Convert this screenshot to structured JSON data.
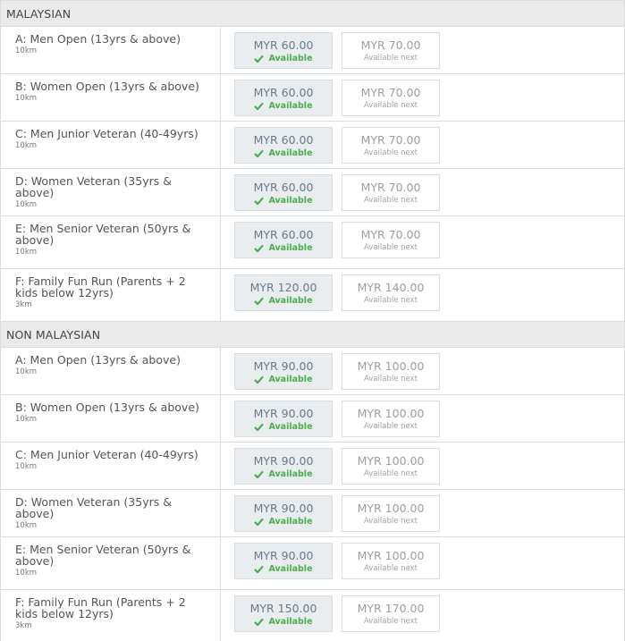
{
  "sections": [
    {
      "title": "MALAYSIAN",
      "rows": [
        {
          "name": "A: Men Open (13yrs & above)",
          "distance": "10km",
          "price": "MYR 60.00",
          "status": "Available",
          "next_price": "MYR 70.00",
          "next_status": "Available next"
        },
        {
          "name": "B: Women Open (13yrs & above)",
          "distance": "10km",
          "price": "MYR 60.00",
          "status": "Available",
          "next_price": "MYR 70.00",
          "next_status": "Available next"
        },
        {
          "name": "C: Men Junior Veteran (40-49yrs)",
          "distance": "10km",
          "price": "MYR 60.00",
          "status": "Available",
          "next_price": "MYR 70.00",
          "next_status": "Available next"
        },
        {
          "name": "D: Women Veteran (35yrs & above)",
          "distance": "10km",
          "price": "MYR 60.00",
          "status": "Available",
          "next_price": "MYR 70.00",
          "next_status": "Available next"
        },
        {
          "name": "E: Men Senior Veteran (50yrs & above)",
          "distance": "10km",
          "price": "MYR 60.00",
          "status": "Available",
          "next_price": "MYR 70.00",
          "next_status": "Available next"
        },
        {
          "name": "F: Family Fun Run (Parents + 2 kids below 12yrs)",
          "distance": "3km",
          "price": "MYR 120.00",
          "status": "Available",
          "next_price": "MYR 140.00",
          "next_status": "Available next"
        }
      ]
    },
    {
      "title": "NON MALAYSIAN",
      "rows": [
        {
          "name": "A: Men Open (13yrs & above)",
          "distance": "10km",
          "price": "MYR 90.00",
          "status": "Available",
          "next_price": "MYR 100.00",
          "next_status": "Available next"
        },
        {
          "name": "B: Women Open (13yrs & above)",
          "distance": "10km",
          "price": "MYR 90.00",
          "status": "Available",
          "next_price": "MYR 100.00",
          "next_status": "Available next"
        },
        {
          "name": "C: Men Junior Veteran (40-49yrs)",
          "distance": "10km",
          "price": "MYR 90.00",
          "status": "Available",
          "next_price": "MYR 100.00",
          "next_status": "Available next"
        },
        {
          "name": "D: Women Veteran (35yrs & above)",
          "distance": "10km",
          "price": "MYR 90.00",
          "status": "Available",
          "next_price": "MYR 100.00",
          "next_status": "Available next"
        },
        {
          "name": "E: Men Senior Veteran (50yrs & above)",
          "distance": "10km",
          "price": "MYR 90.00",
          "status": "Available",
          "next_price": "MYR 100.00",
          "next_status": "Available next"
        },
        {
          "name": "F: Family Fun Run (Parents + 2 kids below 12yrs)",
          "distance": "3km",
          "price": "MYR 150.00",
          "status": "Available",
          "next_price": "MYR 170.00",
          "next_status": "Available next"
        }
      ]
    }
  ],
  "colors": {
    "available": "#4cae4c",
    "header_bg": "#eaeaea",
    "current_price_bg": "#e9edf0"
  },
  "icons": {
    "available": "check-icon"
  }
}
